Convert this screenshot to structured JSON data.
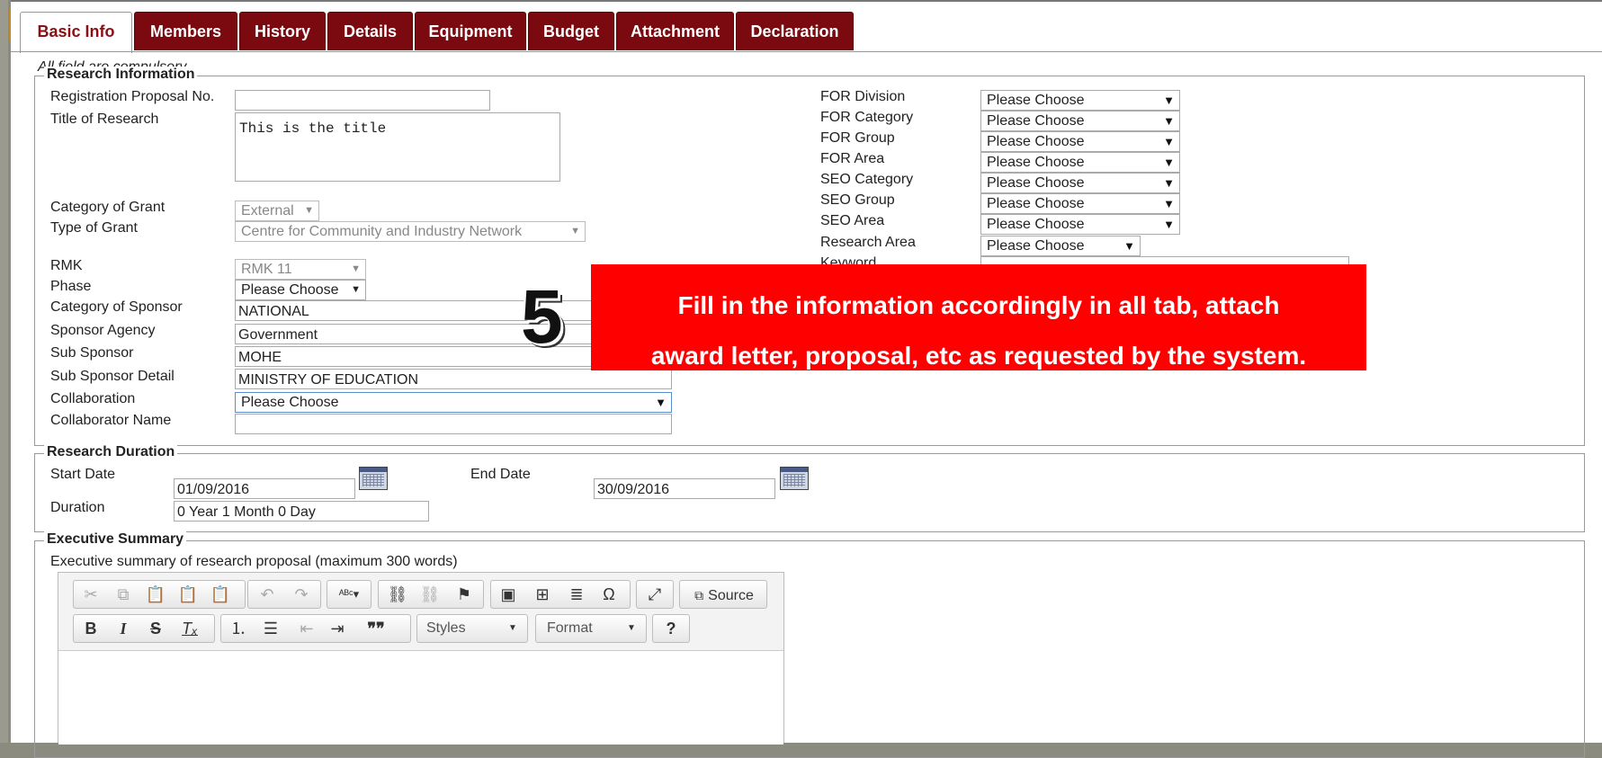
{
  "tabs": [
    "Basic Info",
    "Members",
    "History",
    "Details",
    "Equipment",
    "Budget",
    "Attachment",
    "Declaration"
  ],
  "note": "All field are compulsory",
  "research_info": {
    "legend": "Research Information",
    "registration_label": "Registration Proposal No.",
    "registration_value": "",
    "title_label": "Title of Research",
    "title_value": "This is the title",
    "category_grant_label": "Category of Grant",
    "category_grant_value": "External",
    "type_grant_label": "Type of Grant",
    "type_grant_value": "Centre for Community and Industry Network",
    "rmk_label": "RMK",
    "rmk_value": "RMK 11",
    "phase_label": "Phase",
    "phase_value": "Please Choose",
    "cat_sponsor_label": "Category of Sponsor",
    "cat_sponsor_value": "NATIONAL",
    "sponsor_agency_label": "Sponsor Agency",
    "sponsor_agency_value": "Government",
    "sub_sponsor_label": "Sub Sponsor",
    "sub_sponsor_value": "MOHE",
    "sub_sponsor_detail_label": "Sub Sponsor Detail",
    "sub_sponsor_detail_value": "MINISTRY OF EDUCATION",
    "collaboration_label": "Collaboration",
    "collaboration_value": "Please Choose",
    "collaborator_name_label": "Collaborator Name",
    "collaborator_name_value": "",
    "right_fields": [
      {
        "label": "FOR Division",
        "value": "Please Choose"
      },
      {
        "label": "FOR Category",
        "value": "Please Choose"
      },
      {
        "label": "FOR Group",
        "value": "Please Choose"
      },
      {
        "label": "FOR Area",
        "value": "Please Choose"
      },
      {
        "label": "SEO Category",
        "value": "Please Choose"
      },
      {
        "label": "SEO Group",
        "value": "Please Choose"
      },
      {
        "label": "SEO Area",
        "value": "Please Choose"
      },
      {
        "label": "Research Area",
        "value": "Please Choose"
      }
    ],
    "keyword_label": "Keyword"
  },
  "duration": {
    "legend": "Research Duration",
    "start_label": "Start Date",
    "start_value": "01/09/2016",
    "end_label": "End Date",
    "end_value": "30/09/2016",
    "duration_label": "Duration",
    "duration_value": "0 Year 1 Month 0 Day"
  },
  "summary": {
    "legend": "Executive Summary",
    "desc": "Executive summary of research proposal (maximum 300 words)",
    "source_label": "Source",
    "styles_label": "Styles",
    "format_label": "Format"
  },
  "annotation": {
    "step": "5",
    "line1": "Fill in the information accordingly in all tab, attach",
    "line2": "award letter, proposal, etc as requested by the system."
  },
  "colors": {
    "tab_bg": "#7b0a10",
    "callout": "#ff0000"
  }
}
